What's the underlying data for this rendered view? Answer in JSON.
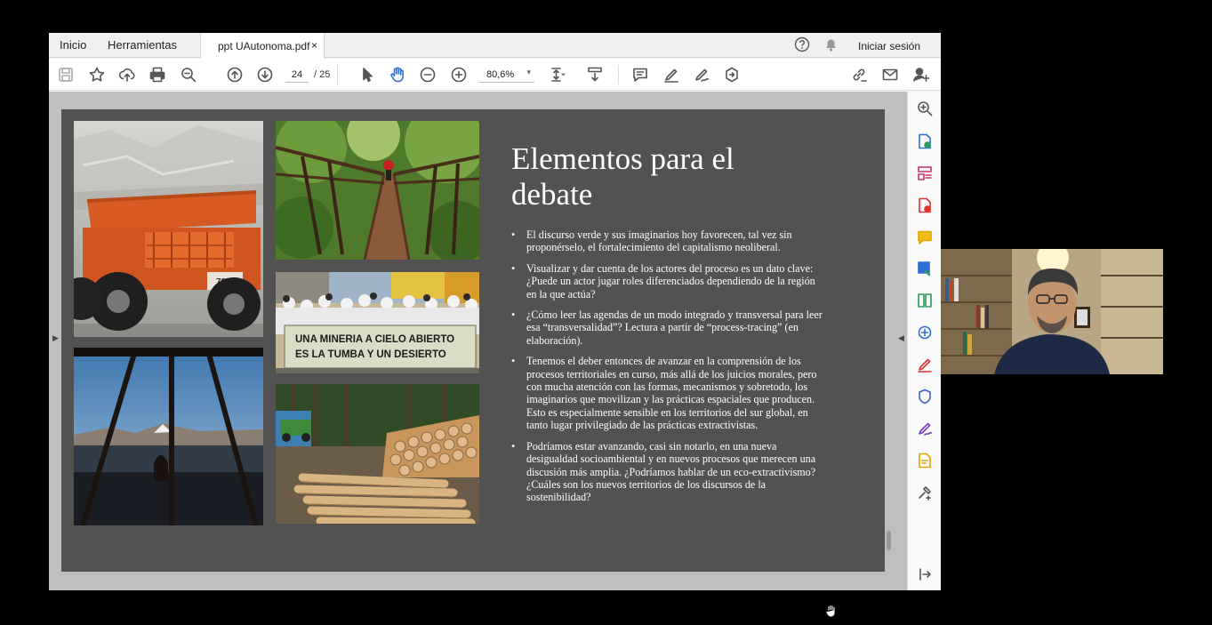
{
  "menubar": {
    "items": [
      "Inicio",
      "Herramientas"
    ],
    "tab_title": "ppt UAutonoma.pdf",
    "tab_close": "×",
    "help_icon": "help-icon",
    "bell_icon": "bell-icon",
    "signin": "Iniciar sesión"
  },
  "toolbar": {
    "page_current": "24",
    "page_total": "/ 25",
    "zoom": "80,6%",
    "icons": [
      "save-icon",
      "star-icon",
      "upload-icon",
      "print-icon",
      "search-zoom-icon",
      "page-up-icon",
      "page-down-icon",
      "select-pointer-icon",
      "hand-tool-icon",
      "zoom-out-icon",
      "zoom-in-icon",
      "fit-page-icon",
      "scroll-mode-icon",
      "comment-icon",
      "highlight-icon",
      "sign-icon",
      "share-icon",
      "link-icon",
      "email-icon",
      "add-user-icon"
    ]
  },
  "slide": {
    "title": "Elementos para el debate",
    "banner_line1": "UNA MINERIA A CIELO ABIERTO",
    "banner_line2": "ES LA TUMBA Y UN DESIERTO",
    "bullets": [
      "El discurso verde y sus imaginarios hoy favorecen, tal vez sin proponérselo, el fortalecimiento del capitalismo neoliberal.",
      "Visualizar y dar cuenta de los actores del proceso es un dato clave: ¿Puede un actor jugar roles diferenciados dependiendo de la región en la que actúa?",
      "¿Cómo leer las agendas de un modo integrado y transversal para leer esa “transversalidad”? Lectura a partir de “process-tracing” (en elaboración).",
      "Tenemos el deber entonces de avanzar en la comprensión de los procesos territoriales en curso, más allá de los juicios morales, pero con mucha atención con las formas, mecanismos y sobretodo, los imaginarios que movilizan y las prácticas espaciales que producen. Esto es especialmente sensible en los territorios del sur global, en tanto lugar privilegiado de las prácticas extractivistas.",
      "Podríamos estar avanzando, casi sin notarlo, en una nueva desigualdad socioambiental y en nuevos procesos que merecen una discusión más amplia. ¿Podríamos hablar de un eco-extractivismo? ¿Cuáles son los nuevos territorios de los discursos de la sostenibilidad?"
    ]
  },
  "right_panel_icons": [
    "zoom-icon",
    "export-pdf-icon",
    "organize-pages-icon",
    "create-pdf-icon",
    "comment-tool-icon",
    "scan-icon",
    "compress-icon",
    "edit-pdf-icon",
    "fill-sign-icon",
    "protect-icon",
    "signature-icon",
    "stamp-icon",
    "more-tools-icon",
    "collapse-panel-icon"
  ],
  "colors": {
    "accent": "#2d6fd6",
    "slide_bg": "#525252",
    "doc_bg": "#bfbfbf"
  }
}
